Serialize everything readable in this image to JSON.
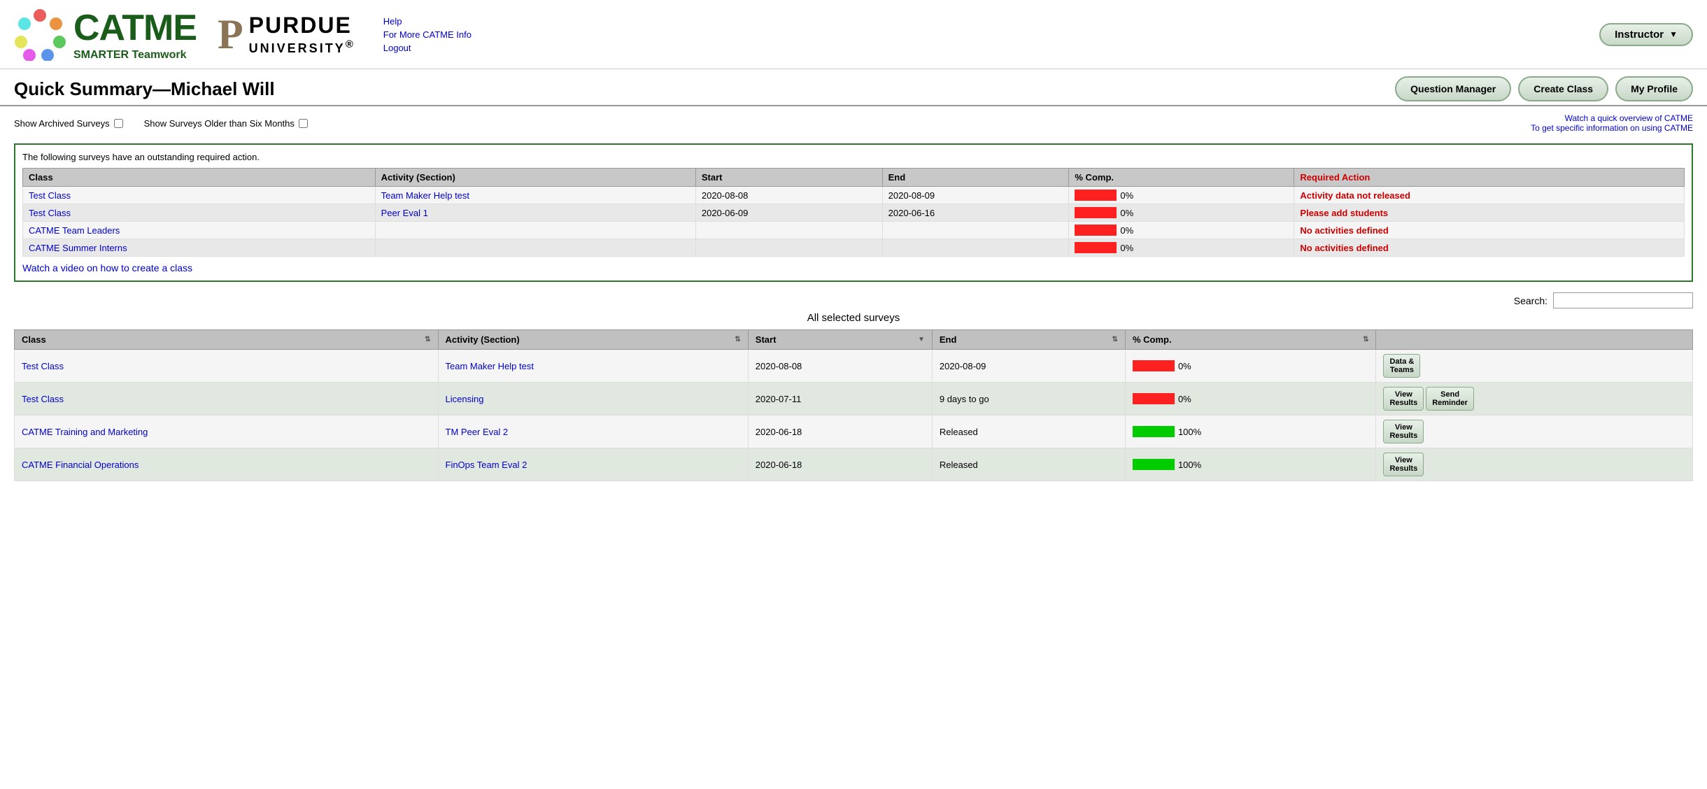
{
  "header": {
    "catme_text": "CATME",
    "smarter": "SMARTER Teamwork",
    "purdue_p": "P",
    "purdue": "PURDUE",
    "university": "UNIVERSITY",
    "links": {
      "help": "Help",
      "more_info": "For More CATME Info",
      "logout": "Logout"
    },
    "instructor_label": "Instructor"
  },
  "page": {
    "title": "Quick Summary—Michael Will",
    "buttons": {
      "question_manager": "Question Manager",
      "create_class": "Create Class",
      "my_profile": "My Profile"
    }
  },
  "filters": {
    "archived": "Show Archived Surveys",
    "older": "Show Surveys Older than Six Months",
    "watch_overview": "Watch a quick overview of CATME",
    "specific_info": "To get specific information on using CATME"
  },
  "required_box": {
    "notice": "The following surveys have an outstanding required action.",
    "headers": {
      "class": "Class",
      "activity": "Activity (Section)",
      "start": "Start",
      "end": "End",
      "pct_comp": "% Comp.",
      "required_action": "Required Action"
    },
    "rows": [
      {
        "class": "Test Class",
        "class_href": "#",
        "activity": "Team Maker Help test",
        "activity_href": "#",
        "start": "2020-08-08",
        "end": "2020-08-09",
        "pct": "0%",
        "bar_type": "red",
        "action": "Activity data not released",
        "action_href": "#"
      },
      {
        "class": "Test Class",
        "class_href": "#",
        "activity": "Peer Eval 1",
        "activity_href": "#",
        "start": "2020-06-09",
        "end": "2020-06-16",
        "pct": "0%",
        "bar_type": "red",
        "action": "Please add students",
        "action_href": "#"
      },
      {
        "class": "CATME Team Leaders",
        "class_href": "#",
        "activity": "",
        "activity_href": "#",
        "start": "",
        "end": "",
        "pct": "0%",
        "bar_type": "red",
        "action": "No activities defined",
        "action_href": "#"
      },
      {
        "class": "CATME Summer Interns",
        "class_href": "#",
        "activity": "",
        "activity_href": "#",
        "start": "",
        "end": "",
        "pct": "0%",
        "bar_type": "red",
        "action": "No activities defined",
        "action_href": "#"
      }
    ],
    "watch_video": "Watch a video on how to create a class"
  },
  "search": {
    "label": "Search:",
    "placeholder": ""
  },
  "surveys": {
    "title": "All selected surveys",
    "headers": {
      "class": "Class",
      "activity": "Activity (Section)",
      "start": "Start",
      "end": "End",
      "pct_comp": "% Comp."
    },
    "rows": [
      {
        "class": "Test Class",
        "class_href": "#",
        "activity": "Team Maker Help test",
        "activity_href": "#",
        "start": "2020-08-08",
        "end": "2020-08-09",
        "pct": "0%",
        "bar_type": "red",
        "actions": [
          "data_teams"
        ],
        "action_labels": {
          "data_teams": "Data &\nTeams"
        }
      },
      {
        "class": "Test Class",
        "class_href": "#",
        "activity": "Licensing",
        "activity_href": "#",
        "start": "2020-07-11",
        "end": "9 days to go",
        "pct": "0%",
        "bar_type": "red",
        "actions": [
          "view_results",
          "send_reminder"
        ],
        "action_labels": {
          "view_results": "View\nResults",
          "send_reminder": "Send\nReminder"
        }
      },
      {
        "class": "CATME Training and Marketing",
        "class_href": "#",
        "activity": "TM Peer Eval 2",
        "activity_href": "#",
        "start": "2020-06-18",
        "end": "Released",
        "pct": "100%",
        "bar_type": "green",
        "actions": [
          "view_results"
        ],
        "action_labels": {
          "view_results": "View\nResults"
        }
      },
      {
        "class": "CATME Financial Operations",
        "class_href": "#",
        "activity": "FinOps Team Eval 2",
        "activity_href": "#",
        "start": "2020-06-18",
        "end": "Released",
        "pct": "100%",
        "bar_type": "green",
        "actions": [
          "view_results"
        ],
        "action_labels": {
          "view_results": "View\nResults"
        }
      }
    ]
  }
}
